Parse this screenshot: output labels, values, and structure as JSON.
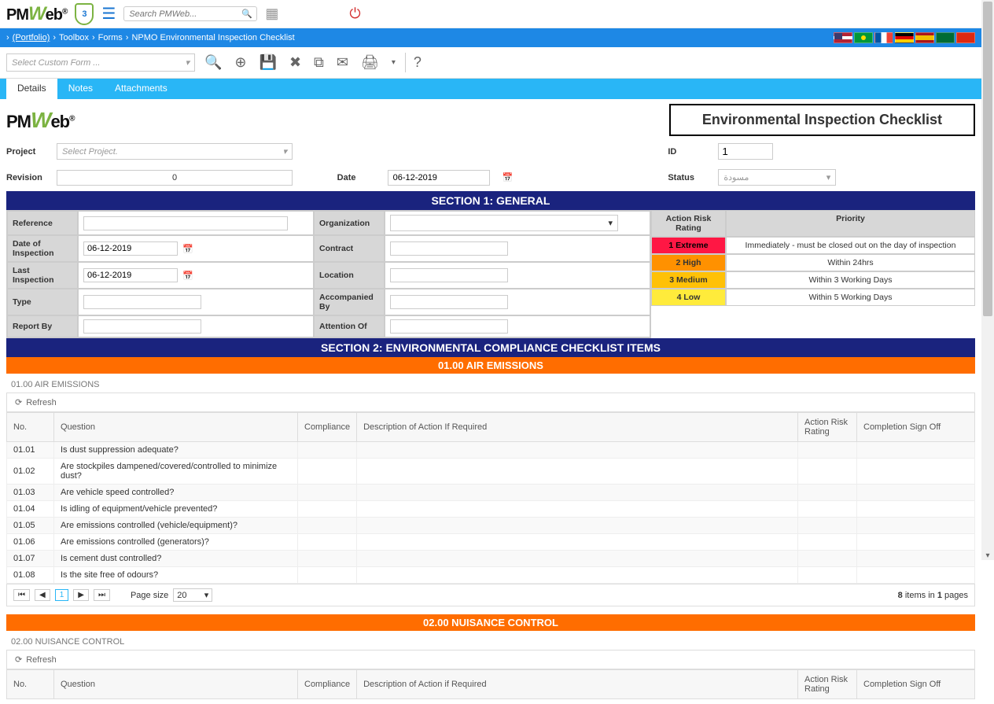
{
  "topbar": {
    "logo_left": "PM",
    "logo_w": "W",
    "logo_right": "eb",
    "logo_reg": "®",
    "shield_count": "3",
    "search_placeholder": "Search PMWeb..."
  },
  "breadcrumb": {
    "portfolio": "(Portfolio)",
    "toolbox": "Toolbox",
    "forms": "Forms",
    "page": "NPMO Environmental Inspection Checklist"
  },
  "toolbar": {
    "custom_form_placeholder": "Select Custom Form ..."
  },
  "tabs": {
    "details": "Details",
    "notes": "Notes",
    "attachments": "Attachments"
  },
  "doc": {
    "title": "Environmental Inspection Checklist"
  },
  "form": {
    "project_label": "Project",
    "project_placeholder": "Select Project.",
    "id_label": "ID",
    "id_value": "1",
    "revision_label": "Revision",
    "revision_value": "0",
    "date_label": "Date",
    "date_value": "06-12-2019",
    "status_label": "Status",
    "status_value": "مسودة"
  },
  "section1": {
    "header": "SECTION 1: GENERAL",
    "reference": "Reference",
    "organization": "Organization",
    "date_inspection": "Date of Inspection",
    "date_inspection_val": "06-12-2019",
    "contract": "Contract",
    "last_inspection": "Last Inspection",
    "last_inspection_val": "06-12-2019",
    "location": "Location",
    "type": "Type",
    "accompanied_by": "Accompanied By",
    "report_by": "Report By",
    "attention_of": "Attention Of",
    "risk_header": "Action Risk Rating",
    "priority_header": "Priority",
    "r1": "1 Extreme",
    "p1": "Immediately - must be closed out on the day of inspection",
    "r2": "2 High",
    "p2": "Within 24hrs",
    "r3": "3 Medium",
    "p3": "Within 3 Working Days",
    "r4": "4 Low",
    "p4": "Within 5 Working Days"
  },
  "section2": {
    "header": "SECTION 2: ENVIRONMENTAL COMPLIANCE CHECKLIST ITEMS",
    "sub1_bar": "01.00 AIR EMISSIONS",
    "sub1_title": "01.00 AIR EMISSIONS",
    "sub2_bar": "02.00 NUISANCE CONTROL",
    "sub2_title": "02.00 NUISANCE CONTROL",
    "refresh": "Refresh",
    "cols": {
      "no": "No.",
      "question": "Question",
      "compliance": "Compliance",
      "description": "Description of Action If Required",
      "description2": "Description of Action if Required",
      "rating": "Action Risk Rating",
      "signoff": "Completion Sign Off"
    },
    "rows": [
      {
        "no": "01.01",
        "q": "Is dust suppression adequate?"
      },
      {
        "no": "01.02",
        "q": "Are stockpiles dampened/covered/controlled to minimize dust?"
      },
      {
        "no": "01.03",
        "q": "Are vehicle speed controlled?"
      },
      {
        "no": "01.04",
        "q": "Is idling of equipment/vehicle prevented?"
      },
      {
        "no": "01.05",
        "q": "Are emissions controlled (vehicle/equipment)?"
      },
      {
        "no": "01.06",
        "q": "Are emissions controlled (generators)?"
      },
      {
        "no": "01.07",
        "q": "Is cement dust controlled?"
      },
      {
        "no": "01.08",
        "q": "Is the site free of odours?"
      }
    ],
    "pager": {
      "page_size_label": "Page size",
      "page_size_value": "20",
      "current_page": "1",
      "items": "8",
      "items_word": "items in",
      "pages": "1",
      "pages_word": "pages"
    }
  }
}
